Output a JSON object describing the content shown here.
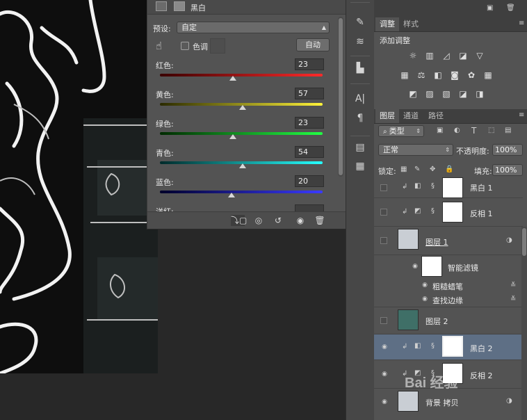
{
  "properties": {
    "title": "黑白",
    "preset_label": "预设:",
    "preset_value": "自定",
    "tint_label": "色调",
    "auto_button": "自动",
    "sliders": [
      {
        "label": "红色:",
        "value": "23",
        "percent": 0.45,
        "gradient": "linear-gradient(90deg,#3a0000,#ff2a2a)"
      },
      {
        "label": "黄色:",
        "value": "57",
        "percent": 0.51,
        "gradient": "linear-gradient(90deg,#2a2a00,#fff33a)"
      },
      {
        "label": "绿色:",
        "value": "23",
        "percent": 0.45,
        "gradient": "linear-gradient(90deg,#002a00,#22ff44)"
      },
      {
        "label": "青色:",
        "value": "54",
        "percent": 0.51,
        "gradient": "linear-gradient(90deg,#002a2a,#26ffff)"
      },
      {
        "label": "蓝色:",
        "value": "20",
        "percent": 0.44,
        "gradient": "linear-gradient(90deg,#00002a,#3a3aff)"
      },
      {
        "label": "洋红:",
        "value": "",
        "percent": 0.5,
        "gradient": "linear-gradient(90deg,#2a002a,#ff33ff)"
      }
    ]
  },
  "adjustments": {
    "tabs": [
      "调整",
      "样式"
    ],
    "title": "添加调整"
  },
  "layers_panel": {
    "tabs": [
      "图层",
      "通道",
      "路径"
    ],
    "filter_label": "类型",
    "blend_mode": "正常",
    "opacity_label": "不透明度:",
    "opacity_value": "100%",
    "lock_label": "锁定:",
    "fill_label": "填充:",
    "fill_value": "100%",
    "layers": [
      {
        "name": "黑白 1",
        "visible": false,
        "selected": false
      },
      {
        "name": "反相 1",
        "visible": false,
        "selected": false
      },
      {
        "name": "图层 1",
        "visible": false,
        "selected": false
      },
      {
        "name": "智能滤镜",
        "visible": true,
        "selected": false
      },
      {
        "name": "粗糙蜡笔",
        "visible": true,
        "selected": false
      },
      {
        "name": "查找边缘",
        "visible": true,
        "selected": false
      },
      {
        "name": "图层 2",
        "visible": false,
        "selected": false
      },
      {
        "name": "黑白 2",
        "visible": true,
        "selected": true
      },
      {
        "name": "反相 2",
        "visible": true,
        "selected": false
      },
      {
        "name": "背景 拷贝",
        "visible": true,
        "selected": false
      }
    ]
  },
  "watermark": "Bai 经验"
}
